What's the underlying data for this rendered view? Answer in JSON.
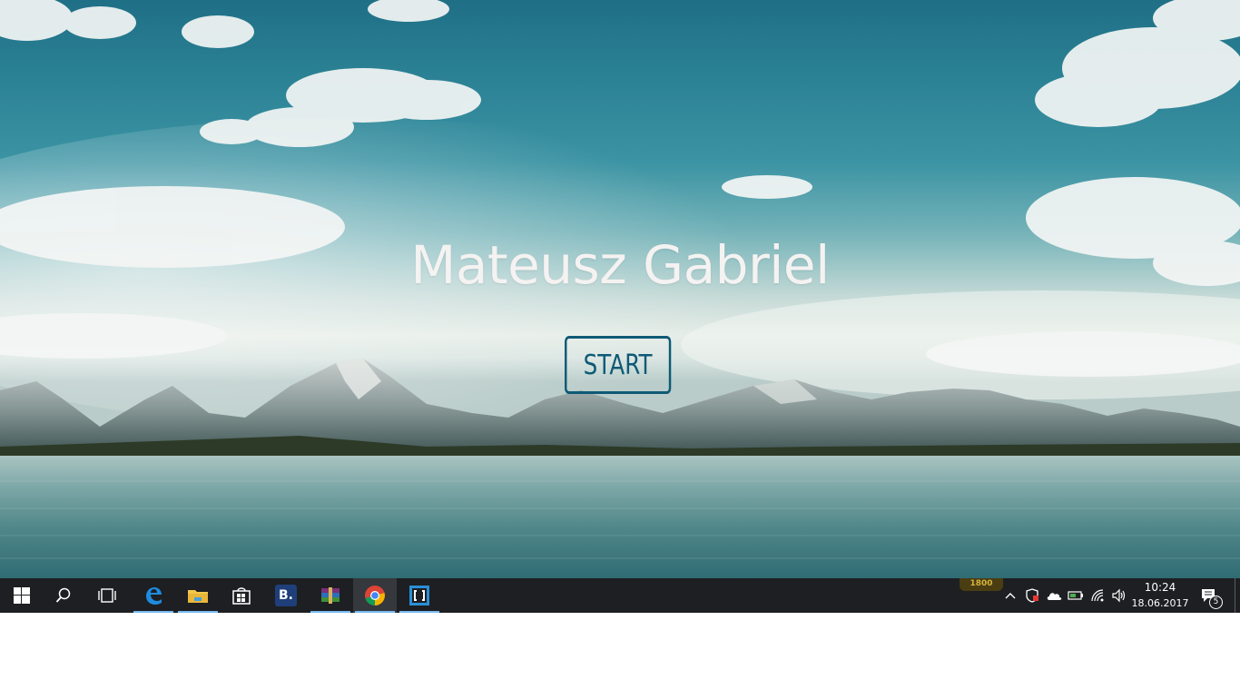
{
  "hero": {
    "title": "Mateusz Gabriel",
    "start_label": "START"
  },
  "taskbar": {
    "apps": [
      {
        "name": "start",
        "icon": "windows-logo-icon"
      },
      {
        "name": "search",
        "icon": "search-icon"
      },
      {
        "name": "task-view",
        "icon": "task-view-icon"
      },
      {
        "name": "edge",
        "icon": "edge-icon",
        "running": true
      },
      {
        "name": "file-explorer",
        "icon": "folder-icon",
        "running": true
      },
      {
        "name": "store",
        "icon": "store-icon"
      },
      {
        "name": "booking",
        "icon": "b-app-icon",
        "label": "B."
      },
      {
        "name": "winrar",
        "icon": "winrar-icon",
        "running": true
      },
      {
        "name": "chrome",
        "icon": "chrome-icon",
        "running": true,
        "focused": true
      },
      {
        "name": "brackets",
        "icon": "brackets-icon",
        "running": true
      }
    ],
    "tray_badge": "1800",
    "clock_time": "10:24",
    "clock_date": "18.06.2017",
    "notification_count": "5"
  },
  "colors": {
    "button_accent": "#0e5a76",
    "taskbar_bg": "#1d1f22",
    "active_indicator": "#76b9ed"
  }
}
